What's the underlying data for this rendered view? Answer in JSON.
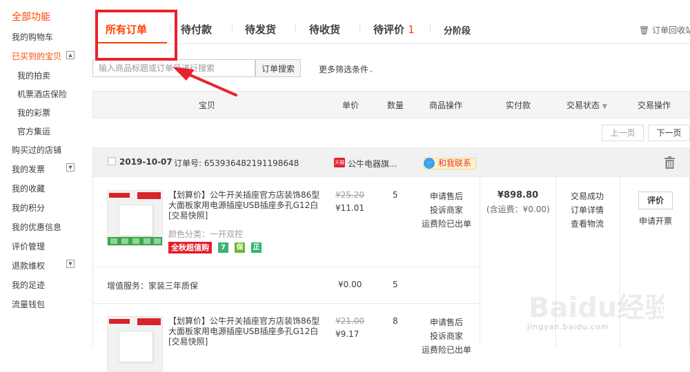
{
  "sidebar": {
    "items": [
      {
        "label": "全部功能"
      },
      {
        "label": "我的购物车"
      },
      {
        "label": "已买到的宝贝"
      },
      {
        "label": "我的拍卖"
      },
      {
        "label": "机票酒店保险"
      },
      {
        "label": "我的彩票"
      },
      {
        "label": "官方集运"
      },
      {
        "label": "购买过的店铺"
      },
      {
        "label": "我的发票"
      },
      {
        "label": "我的收藏"
      },
      {
        "label": "我的积分"
      },
      {
        "label": "我的优惠信息"
      },
      {
        "label": "评价管理"
      },
      {
        "label": "退款维权"
      },
      {
        "label": "我的足迹"
      },
      {
        "label": "流量钱包"
      }
    ]
  },
  "tabs": [
    {
      "label": "所有订单"
    },
    {
      "label": "待付款"
    },
    {
      "label": "待发货"
    },
    {
      "label": "待收货"
    },
    {
      "label": "待评价",
      "count": "1"
    },
    {
      "label": "分阶段"
    }
  ],
  "recycle_label": "订单回收站",
  "search": {
    "placeholder": "输入商品标题或订单号进行搜索",
    "button": "订单搜索",
    "more_filters": "更多筛选条件"
  },
  "columns": [
    "宝贝",
    "单价",
    "数量",
    "商品操作",
    "实付款",
    "交易状态",
    "交易操作"
  ],
  "pager": {
    "prev": "上一页",
    "next": "下一页"
  },
  "order": {
    "date": "2019-10-07",
    "order_no": "订单号: 653936482191198648",
    "shop_badge": "天猫",
    "shop": "公牛电器旗...",
    "contact": "和我联系",
    "paid": "¥898.80",
    "shipping": "(含运费：¥0.00)",
    "status": [
      "交易成功",
      "订单详情",
      "查看物流"
    ],
    "review_button": "评价",
    "invoice": "申请开票",
    "items": [
      {
        "title": "【划算价】公牛开关插座官方店装饰86型大面板家用电源插座USB插座多孔G12白 [交易快照]",
        "sku": "颜色分类：一开双控",
        "promo": "全秋超值购",
        "badges": [
          "7",
          "保",
          "正"
        ],
        "price_original": "¥25.20",
        "price": "¥11.01",
        "qty": "5",
        "ops": [
          "申请售后",
          "投诉商家",
          "运费险已出单"
        ]
      },
      {
        "title": "【划算价】公牛开关插座官方店装饰86型大面板家用电源插座USB插座多孔G12白 [交易快照]",
        "price_original": "¥21.00",
        "price": "¥9.17",
        "qty": "8",
        "ops": [
          "申请售后",
          "投诉商家",
          "运费险已出单"
        ]
      }
    ],
    "service": {
      "label": "增值服务：家装三年质保",
      "price": "¥0.00",
      "qty": "5"
    }
  },
  "watermark": {
    "text": "Baidu经验",
    "url": "jingyan.baidu.com"
  },
  "colors": {
    "accent": "#ff4400",
    "annotation": "#e8232b",
    "tmall": "#e4202d"
  }
}
